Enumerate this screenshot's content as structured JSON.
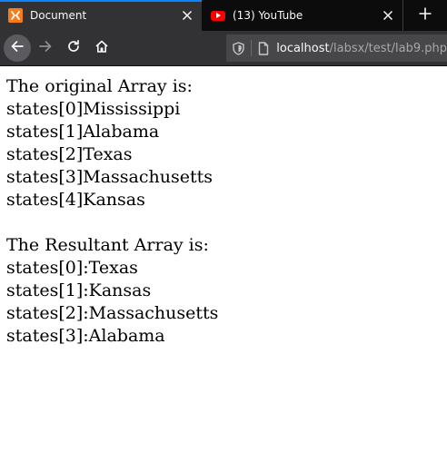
{
  "tabs": [
    {
      "title": "Document",
      "favicon": "xampp-icon",
      "active": true
    },
    {
      "title": "(13) YouTube",
      "favicon": "youtube-icon",
      "active": false
    }
  ],
  "nav": {
    "url_host": "localhost",
    "url_path": "/labsx/test/lab9.php"
  },
  "page": {
    "original_heading": "The original Array is:",
    "original_items": [
      "states[0]Mississippi",
      "states[1]Alabama",
      "states[2]Texas",
      "states[3]Massachusetts",
      "states[4]Kansas"
    ],
    "result_heading": "The Resultant Array is:",
    "result_items": [
      "states[0]:Texas",
      "states[1]:Kansas",
      "states[2]:Massachusetts",
      "states[3]:Alabama"
    ]
  },
  "colors": {
    "tab_active_accent": "#0a84ff",
    "chrome_dark": "#0c0c0d",
    "chrome_toolbar": "#323234"
  }
}
